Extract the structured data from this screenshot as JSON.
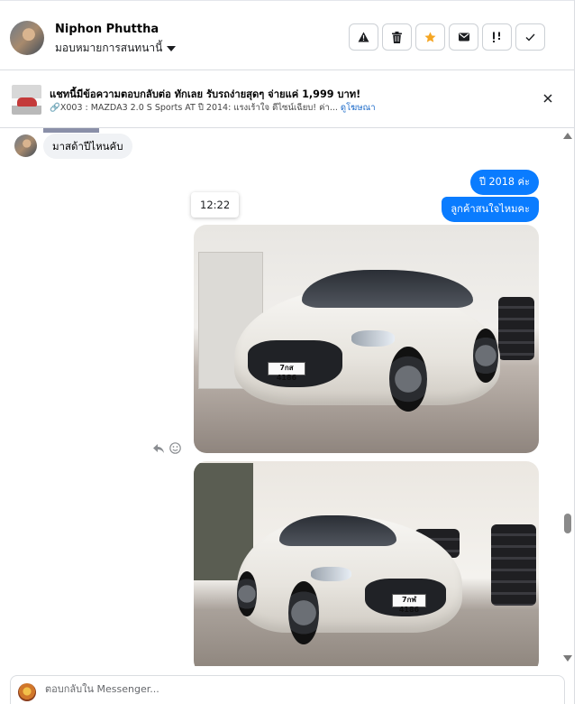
{
  "header": {
    "name": "Niphon Phuttha",
    "assign_label": "มอบหมายการสนทนานี้",
    "actions": [
      "spam-icon",
      "trash-icon",
      "star-icon",
      "mail-icon",
      "follow-up-icon",
      "done-icon"
    ],
    "star_color": "#f5a623"
  },
  "banner": {
    "title": "แชทนี้มีข้อความตอบกลับต่อ ทักเลย รับรถง่ายสุดๆ จ่ายแค่ 1,999 บาท!",
    "subtitle": "X003 : MAZDA3 2.0 S Sports AT ปี 2014: แรงเร้าใจ ดีไซน์เฉียบ! ค่า...",
    "link": "ดูโฆษณา"
  },
  "conversation": {
    "incoming_message": "มาสด้าปีไหนคับ",
    "outgoing_messages": [
      "ปี 2018 ค่ะ",
      "ลูกค้าสนใจไหมคะ"
    ],
    "timestamp": "12:22",
    "photos": [
      {
        "plate": "7กส 4186"
      },
      {
        "plate": "7กฬ 4186"
      }
    ],
    "accent_color": "#0a7cff"
  },
  "composer": {
    "placeholder": "ตอบกลับใน Messenger..."
  }
}
